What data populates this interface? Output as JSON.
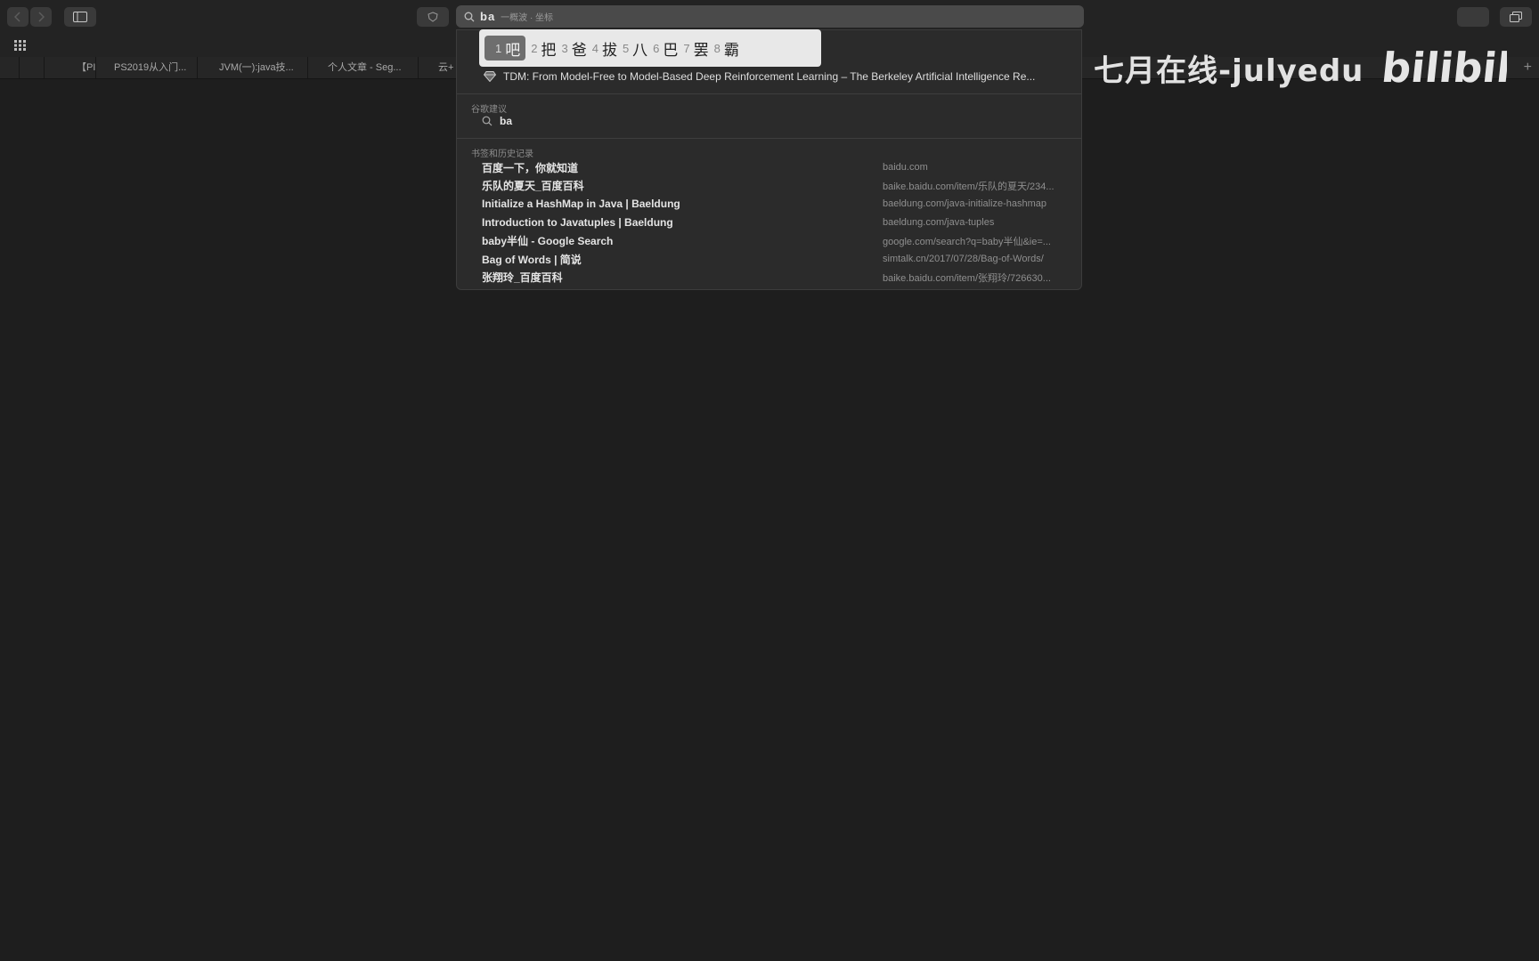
{
  "toolbar": {
    "typed_text": "ba",
    "completion_text": "一概波 · 坐标"
  },
  "ime": {
    "candidates": [
      {
        "num": "1",
        "char": "吧"
      },
      {
        "num": "2",
        "char": "把"
      },
      {
        "num": "3",
        "char": "爸"
      },
      {
        "num": "4",
        "char": "拔"
      },
      {
        "num": "5",
        "char": "八"
      },
      {
        "num": "6",
        "char": "巴"
      },
      {
        "num": "7",
        "char": "罢"
      },
      {
        "num": "8",
        "char": "霸"
      }
    ]
  },
  "tabs": [
    "【PI",
    "PS2019从入门...",
    "JVM(一):java技...",
    "个人文章 - Seg...",
    "云+"
  ],
  "watermark": {
    "text": "七月在线-julyedu",
    "logo": "bilibili"
  },
  "dropdown": {
    "top_hit": "TDM: From Model-Free to Model-Based Deep Reinforcement Learning – The Berkeley Artificial Intelligence Re...",
    "suggestions_header": "谷歌建议",
    "suggestion": "ba",
    "history_header": "书签和历史记录",
    "history": [
      {
        "title": "百度一下，你就知道",
        "url": "baidu.com"
      },
      {
        "title": "乐队的夏天_百度百科",
        "url": "baike.baidu.com/item/乐队的夏天/234..."
      },
      {
        "title": "Initialize a HashMap in Java | Baeldung",
        "url": "baeldung.com/java-initialize-hashmap"
      },
      {
        "title": "Introduction to Javatuples | Baeldung",
        "url": "baeldung.com/java-tuples"
      },
      {
        "title": "baby半仙 - Google Search",
        "url": "google.com/search?q=baby半仙&ie=..."
      },
      {
        "title": "Bag of Words | 简说",
        "url": "simtalk.cn/2017/07/28/Bag-of-Words/"
      },
      {
        "title": "张翔玲_百度百科",
        "url": "baike.baidu.com/item/张翔玲/726630..."
      }
    ]
  }
}
